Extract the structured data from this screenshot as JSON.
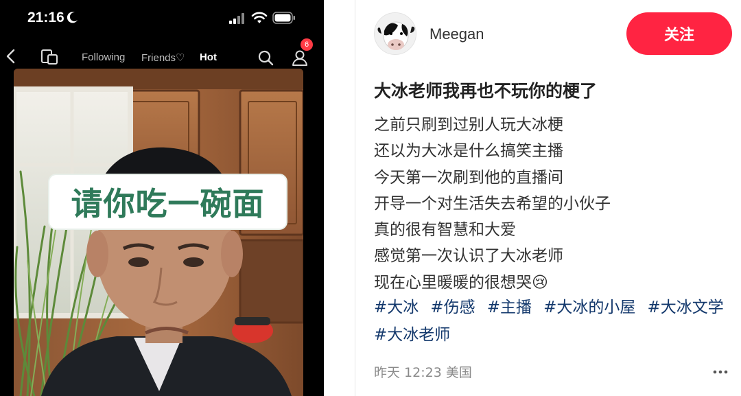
{
  "phone": {
    "status_time": "21:16",
    "nav_tabs": [
      {
        "label": "Following",
        "active": false
      },
      {
        "label": "Friends♡",
        "active": false
      },
      {
        "label": "Hot",
        "active": true
      }
    ],
    "notification_count": "6",
    "video_caption": "请你吃一碗面",
    "icons": [
      "moon-icon",
      "signal-icon",
      "wifi-icon",
      "battery-icon",
      "back-icon",
      "square-icon",
      "search-icon",
      "profile-icon"
    ]
  },
  "post": {
    "author": "Meegan",
    "follow_label": "关注",
    "title": "大冰老师我再也不玩你的梗了",
    "body_lines": [
      "之前只刷到过别人玩大冰梗",
      "还以为大冰是什么搞笑主播",
      "今天第一次刷到他的直播间",
      "开导一个对生活失去希望的小伙子",
      "真的很有智慧和大爱",
      "感觉第一次认识了大冰老师",
      "现在心里暖暖的很想哭😢"
    ],
    "hashtags": [
      "#大冰",
      "#伤感",
      "#主播",
      "#大冰的小屋",
      "#大冰文学",
      "#大冰老师"
    ],
    "meta": "昨天 12:23 美国",
    "colors": {
      "follow_bg": "#ff2442",
      "hashtag": "#13386c",
      "caption_text": "#2f7a5a"
    }
  }
}
